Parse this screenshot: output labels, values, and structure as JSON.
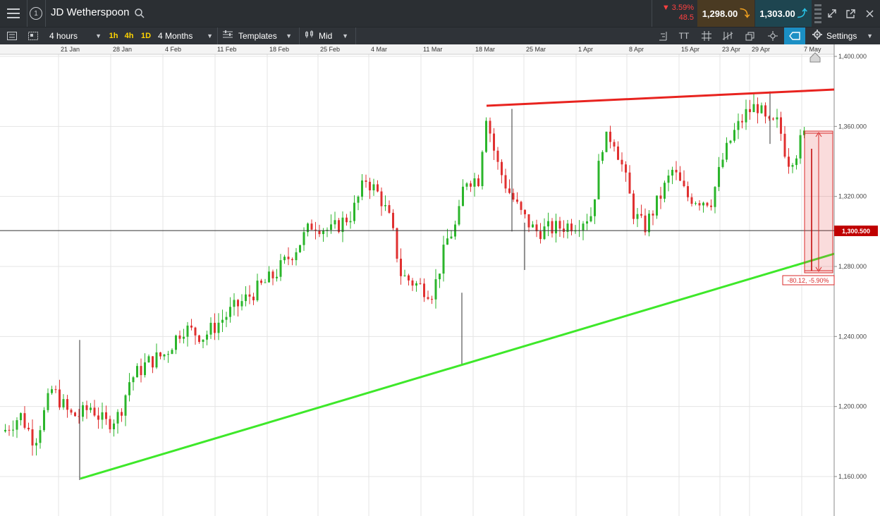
{
  "app": {
    "instrument": "JD Wetherspoon",
    "change_pct": "▼ 3.59%",
    "change_abs": "48.5",
    "sell_price": "1,298.00",
    "buy_price": "1,303.00",
    "info_number": "1"
  },
  "toolbar": {
    "interval": "4 hours",
    "quick_intervals": [
      "1h",
      "4h",
      "1D"
    ],
    "range": "4 Months",
    "templates": "Templates",
    "price_type": "Mid",
    "text_tool": "TT",
    "settings": "Settings"
  },
  "chart_data": {
    "type": "candlestick",
    "x_tick_labels": [
      "21 Jan",
      "28 Jan",
      "4 Feb",
      "11 Feb",
      "18 Feb",
      "25 Feb",
      "4 Mar",
      "11 Mar",
      "18 Mar",
      "25 Mar",
      "1 Apr",
      "8 Apr",
      "15 Apr",
      "23 Apr",
      "29 Apr",
      "7 May"
    ],
    "y_tick_labels": [
      "1,400.000",
      "1,360.000",
      "1,320.000",
      "1,280.000",
      "1,240.000",
      "1,200.000",
      "1,160.000"
    ],
    "ylim": [
      1150,
      1402
    ],
    "current_price_label": "1,300.500",
    "current_price": 1300.5,
    "measure_label": "-80.12, -5.90%",
    "colors": {
      "up": "#2bb52b",
      "down": "#e03030",
      "resistance": "#e8231f",
      "support": "#3ee82a",
      "current": "#c00000"
    }
  }
}
